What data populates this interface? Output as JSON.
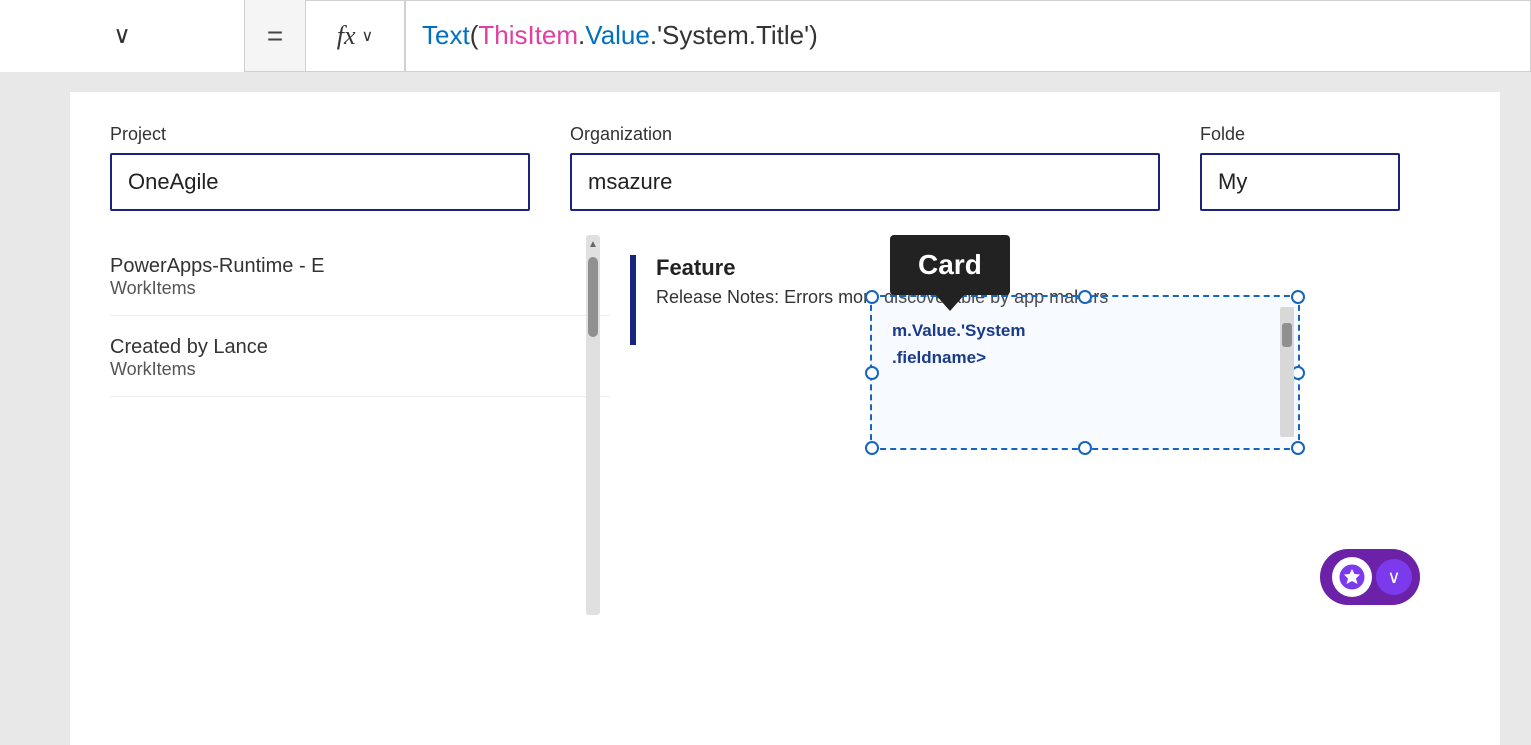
{
  "formulaBar": {
    "dropdown_chevron": "∨",
    "equals_sign": "=",
    "fx_label": "fx",
    "fx_chevron": "∨",
    "expression": {
      "func": "Text",
      "open_paren": "(",
      "this_item": "ThisItem",
      "dot1": ".",
      "value": "Value",
      "dot2": ".",
      "field": "'System.Title'",
      "close_paren": ")"
    }
  },
  "fields": {
    "project_label": "Project",
    "project_value": "OneAgile",
    "org_label": "Organization",
    "org_value": "msazure",
    "folder_label": "Folde",
    "folder_value": "My"
  },
  "listItems": [
    {
      "title": "PowerApps-Runtime - E",
      "subtitle": "WorkItems"
    },
    {
      "title": "Created by Lance",
      "subtitle": "WorkItems"
    }
  ],
  "feature": {
    "title": "Feature",
    "description": "Release Notes: Errors more discoverable by app makers"
  },
  "cardTooltip": {
    "label": "Card"
  },
  "selectedCard": {
    "text_line1": "m.Value.'System",
    "text_line2": ".fieldname>"
  },
  "aiButton": {
    "label": "AI Assistant"
  },
  "scrollbar": {
    "up_arrow": "▲"
  }
}
